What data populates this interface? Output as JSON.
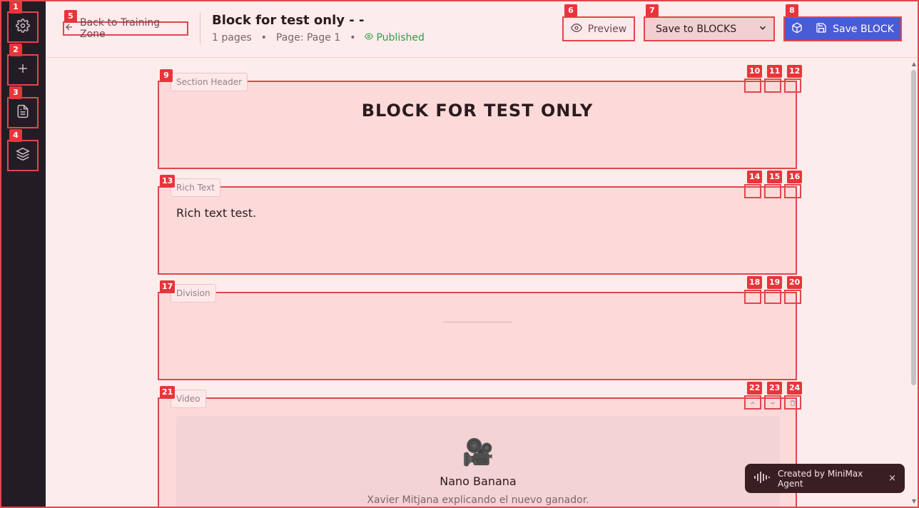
{
  "sidebar": {
    "items": [
      {
        "id": "1",
        "icon": "gear-icon"
      },
      {
        "id": "2",
        "icon": "plus-icon"
      },
      {
        "id": "3",
        "icon": "document-icon"
      },
      {
        "id": "4",
        "icon": "layers-icon"
      }
    ]
  },
  "header": {
    "back_label": "Back to Training Zone",
    "title": "Block for test only - -",
    "pages_count": "1 pages",
    "page_label": "Page: Page 1",
    "separator": "•",
    "status": "Published",
    "preview_label": "Preview",
    "save_select_value": "Save to BLOCKS",
    "save_button_label": "Save BLOCK",
    "badges": {
      "back": "5",
      "preview": "6",
      "select": "7",
      "save": "8"
    }
  },
  "blocks": [
    {
      "id": "9",
      "type_label": "Section Header",
      "content": "BLOCK FOR TEST ONLY",
      "controls": [
        "10",
        "11",
        "12"
      ]
    },
    {
      "id": "13",
      "type_label": "Rich Text",
      "content": "Rich text test.",
      "controls": [
        "14",
        "15",
        "16"
      ]
    },
    {
      "id": "17",
      "type_label": "Division",
      "content": "",
      "controls": [
        "18",
        "19",
        "20"
      ]
    },
    {
      "id": "21",
      "type_label": "Video",
      "video_title": "Nano Banana",
      "video_desc": "Xavier Mitjana explicando el nuevo ganador.",
      "controls": [
        "22",
        "23",
        "24"
      ]
    }
  ],
  "toast": {
    "text": "Created by MiniMax Agent",
    "close": "×"
  },
  "colors": {
    "accent": "#e0474c",
    "primary_button": "#4a5bd6",
    "published": "#2e9e4a",
    "sidebar_bg": "#241c24"
  }
}
